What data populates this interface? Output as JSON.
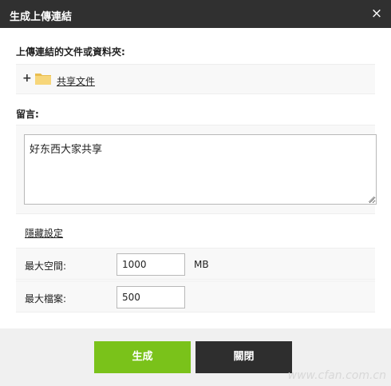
{
  "dialog": {
    "title": "生成上傳連結",
    "close_glyph": "×"
  },
  "upload_section": {
    "label": "上傳連結的文件或資料夾:",
    "expand_glyph": "+",
    "folder_name": "共享文件",
    "folder_icon": "folder-icon"
  },
  "message_section": {
    "label": "留言:",
    "value": "好东西大家共享"
  },
  "advanced": {
    "link_label": "隱藏設定"
  },
  "fields": {
    "max_space": {
      "label": "最大空間:",
      "value": "1000",
      "unit": "MB"
    },
    "max_files": {
      "label": "最大檔案:",
      "value": "500"
    }
  },
  "footer": {
    "create_label": "生成",
    "close_label": "關閉"
  },
  "watermark": "www.cfan.com.cn",
  "colors": {
    "titlebar": "#303030",
    "create_button": "#7ac21a",
    "close_button": "#2e2e2e",
    "footer": "#f0f0f0",
    "folder": "#f5d373"
  }
}
